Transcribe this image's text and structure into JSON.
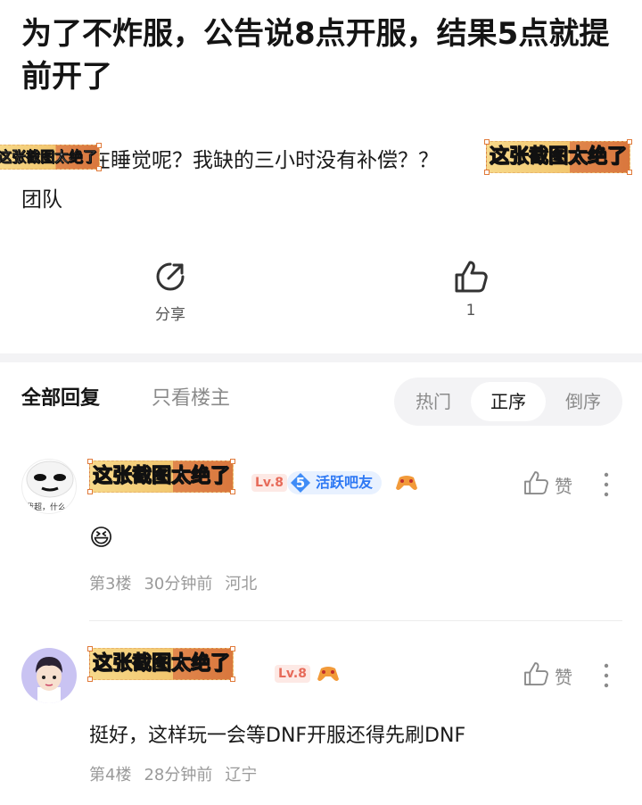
{
  "post": {
    "title": "为了不炸服，公告说8点开服，结果5点就提前开了",
    "body_prefix": "了在睡觉呢？我缺的三小时没有补偿？？",
    "body_suffix": "团队",
    "sticker_text": "这张截图太绝了"
  },
  "actions": {
    "share_label": "分享",
    "like_count": "1"
  },
  "tabs": {
    "all": "全部回复",
    "op_only": "只看楼主"
  },
  "sort": {
    "hot": "热门",
    "asc": "正序",
    "desc": "倒序",
    "selected": "正序"
  },
  "comments": [
    {
      "name_sticker": "这张截图太绝了",
      "level": "Lv.8",
      "active_level": "5",
      "active_label": "活跃吧友",
      "emoji": "😆",
      "floor": "第3楼",
      "time": "30分钟前",
      "location": "河北",
      "like_label": "赞",
      "avatar_caption": "我超，什么"
    },
    {
      "name_sticker": "这张截图太绝了",
      "level": "Lv.8",
      "text": "挺好，这样玩一会等DNF开服还得先刷DNF",
      "floor": "第4楼",
      "time": "28分钟前",
      "location": "辽宁",
      "like_label": "赞"
    }
  ],
  "colors": {
    "accent_blue": "#2d78f4",
    "level_red": "#e76b5a",
    "sticker_yellow": "#f2c66e",
    "sticker_orange": "#d9773d"
  }
}
